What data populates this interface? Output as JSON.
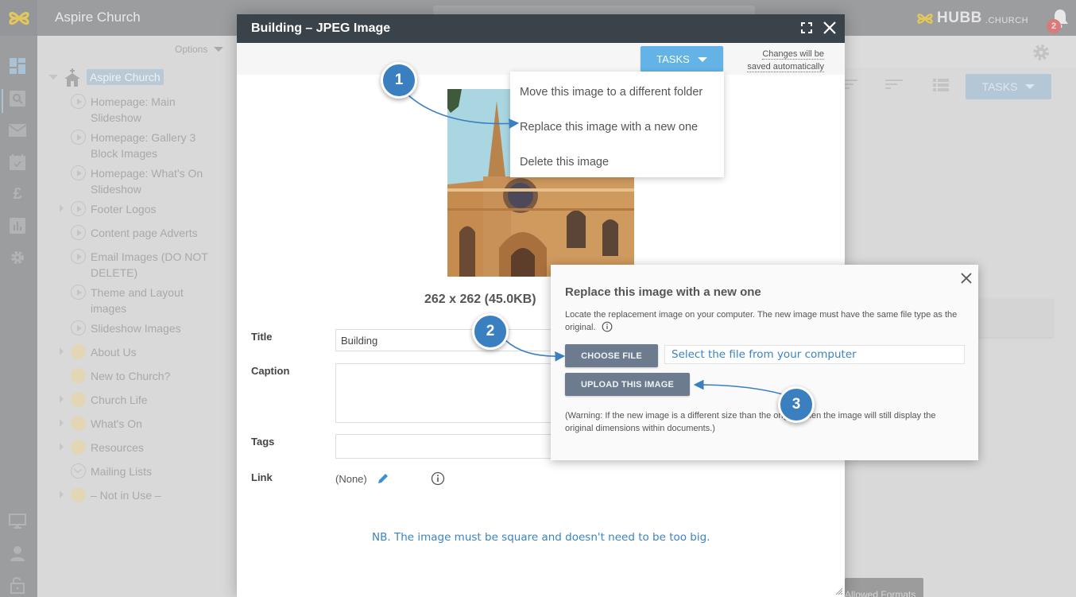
{
  "app": {
    "title": "Aspire Church",
    "brand_main": "HUBB",
    "brand_suffix": ".CHURCH",
    "notification_count": "2",
    "colors": {
      "accent": "#64b3e6",
      "header": "#3b434a",
      "callout": "#3a80c1",
      "note": "#3c83c0"
    }
  },
  "rail": {
    "icons": [
      "dashboard-icon",
      "search-icon",
      "mail-icon",
      "calendar-icon",
      "pound-icon",
      "chart-icon",
      "gear-icon",
      "monitor-icon",
      "user-icon",
      "lock-icon"
    ]
  },
  "tree": {
    "options_label": "Options",
    "root_label": "Aspire Church",
    "items": [
      {
        "label": "Homepage: Main Slideshow",
        "icon": "play-circle-icon",
        "expandable": false
      },
      {
        "label": "Homepage: Gallery 3 Block Images",
        "icon": "play-circle-icon",
        "expandable": false
      },
      {
        "label": "Homepage: What's On Slideshow",
        "icon": "play-circle-icon",
        "expandable": false
      },
      {
        "label": "Footer Logos",
        "icon": "play-circle-icon",
        "expandable": true
      },
      {
        "label": "Content page Adverts",
        "icon": "play-circle-icon",
        "expandable": false
      },
      {
        "label": "Email Images (DO NOT DELETE)",
        "icon": "play-circle-icon",
        "expandable": false
      },
      {
        "label": "Theme and Layout images",
        "icon": "play-circle-icon",
        "expandable": false
      },
      {
        "label": "Slideshow Images",
        "icon": "play-circle-icon",
        "expandable": false
      },
      {
        "label": "About Us",
        "icon": "folder-circle-icon",
        "expandable": true
      },
      {
        "label": "New to Church?",
        "icon": "folder-circle-icon",
        "expandable": false
      },
      {
        "label": "Church Life",
        "icon": "folder-circle-icon",
        "expandable": true
      },
      {
        "label": "What's On",
        "icon": "folder-circle-icon",
        "expandable": true
      },
      {
        "label": "Resources",
        "icon": "folder-circle-icon",
        "expandable": true
      },
      {
        "label": "Mailing Lists",
        "icon": "envelope-circle-icon",
        "expandable": false
      },
      {
        "label": "– Not in Use –",
        "icon": "folder-circle-icon",
        "expandable": true
      }
    ]
  },
  "background": {
    "tasks_label": "TASKS",
    "formats_label": "Allowed Formats"
  },
  "modal": {
    "title": "Building – JPEG Image",
    "tasks_label": "TASKS",
    "autosave_line1": "Changes will be",
    "autosave_line2": "saved automatically",
    "image_alt": "Cathedral building photo",
    "dimensions": "262 x 262 (45.0KB)",
    "form": {
      "title_label": "Title",
      "title_value": "Building",
      "caption_label": "Caption",
      "caption_value": "",
      "tags_label": "Tags",
      "tags_value": "",
      "link_label": "Link",
      "link_value": "(None)"
    },
    "note": "NB. The image must be square and doesn't need to be too big."
  },
  "tasks_menu": {
    "items": [
      "Move this image to a different folder",
      "Replace this image with a new one",
      "Delete this image"
    ]
  },
  "replace_dialog": {
    "title": "Replace this image with a new one",
    "description": "Locate the replacement image on your computer. The new image must have the same file type as the original.",
    "choose_file_label": "CHOOSE FILE",
    "file_annotation": "Select the file from your computer",
    "upload_label": "UPLOAD THIS IMAGE",
    "warning": "(Warning: If the new image is a different size than the original then the image will still display the original dimensions within documents.)"
  },
  "callouts": [
    "1",
    "2",
    "3"
  ]
}
